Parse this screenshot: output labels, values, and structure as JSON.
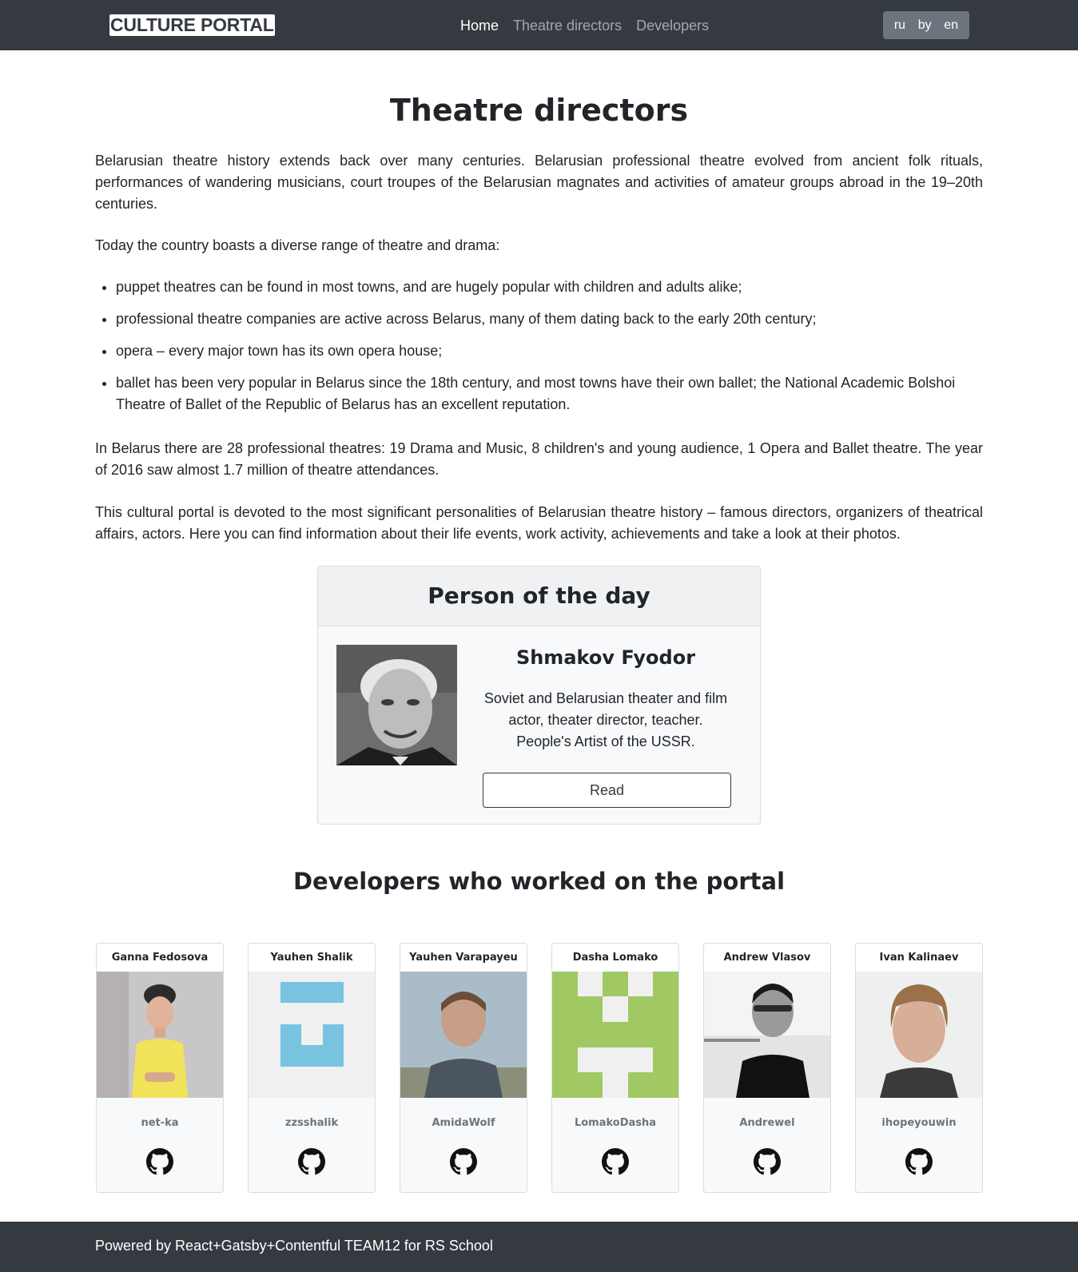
{
  "header": {
    "brand": "CULTURE PORTAL",
    "nav": [
      "Home",
      "Theatre directors",
      "Developers"
    ],
    "active_nav": "Home",
    "languages": [
      "ru",
      "by",
      "en"
    ]
  },
  "main": {
    "title": "Theatre directors",
    "paragraphs": [
      "Belarusian theatre history extends back over many centuries. Belarusian professional theatre evolved from ancient folk rituals, performances of wandering musicians, court troupes of the Belarusian magnates and activities of amateur groups abroad in the 19–20th centuries.",
      "Today the country boasts a diverse range of theatre and drama:",
      "In Belarus there are 28 professional theatres: 19 Drama and Music, 8 children's and young audience, 1 Opera and Ballet theatre. The year of 2016 saw almost 1.7 million of theatre attendances.",
      "This cultural portal is devoted to the most significant personalities of Belarusian theatre history – famous directors, organizers of theatrical affairs, actors. Here you can find information about their life events, work activity, achievements and take a look at their photos."
    ],
    "bullets": [
      "puppet theatres can be found in most towns, and are hugely popular with children and adults alike;",
      "professional theatre companies are active across Belarus, many of them dating back to the early 20th century;",
      "opera – every major town has its own opera house;",
      "ballet has been very popular in Belarus since the 18th century, and most towns have their own ballet; the National Academic Bolshoi Theatre of Ballet of the Republic of Belarus has an excellent reputation."
    ]
  },
  "person_of_day": {
    "header": "Person of the day",
    "name": "Shmakov Fyodor",
    "description": "Soviet and Belarusian theater and film actor, theater director, teacher. People's Artist of the USSR.",
    "button": "Read"
  },
  "developers": {
    "title": "Developers who worked on the portal",
    "items": [
      {
        "name": "Ganna Fedosova",
        "login": "net-ka"
      },
      {
        "name": "Yauhen Shalik",
        "login": "zzsshalik"
      },
      {
        "name": "Yauhen Varapayeu",
        "login": "AmidaWolf"
      },
      {
        "name": "Dasha Lomako",
        "login": "LomakoDasha"
      },
      {
        "name": "Andrew Vlasov",
        "login": "Andrewel"
      },
      {
        "name": "Ivan Kalinaev",
        "login": "ihopeyouwin"
      }
    ]
  },
  "footer": {
    "text": "Powered by React+Gatsby+Contentful TEAM12 for RS School"
  },
  "colors": {
    "navbar_bg": "#343a40",
    "lang_bg": "#6c757d",
    "identicon_blue": "#78c3e0",
    "identicon_green": "#a0c963"
  }
}
